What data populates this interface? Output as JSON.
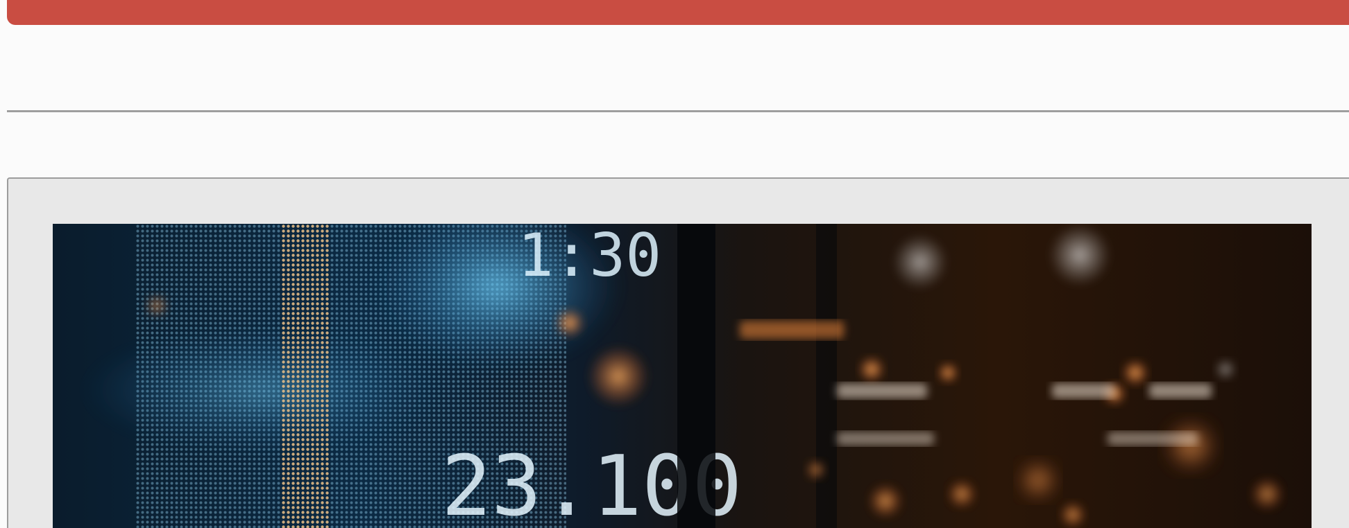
{
  "colors": {
    "accent_bar": "#c94d42",
    "page_background": "#fbfbfb",
    "divider": "#9e9e9e",
    "panel_background": "#e8e8e8",
    "panel_border": "#9c9c9c"
  },
  "hero_image": {
    "subject": "stock-ticker-display-photo",
    "ticker_digits_top": "1:30",
    "ticker_digits_bottom": "23.100"
  }
}
